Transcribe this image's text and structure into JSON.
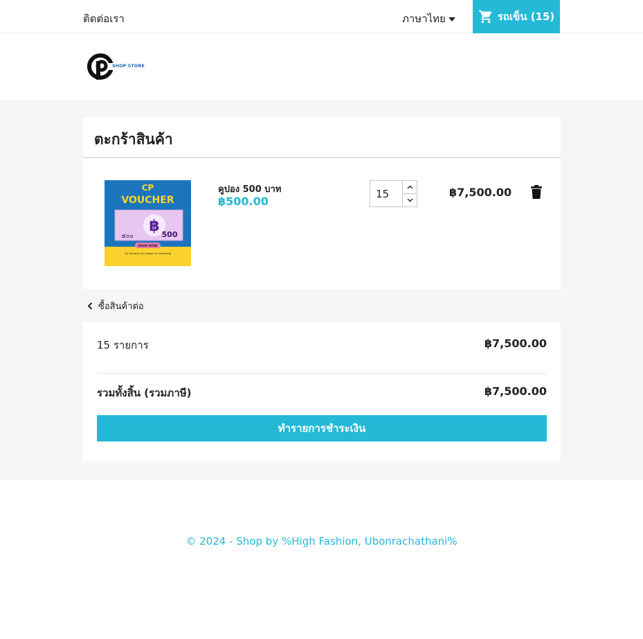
{
  "topbar": {
    "contact_label": "ติดต่อเรา",
    "language_label": "ภาษาไทย",
    "cart_label": "รถเข็น (15)"
  },
  "header": {
    "logo_letter": "P",
    "logo_text": "SHOP STORE"
  },
  "cart": {
    "title": "ตะกร้าสินค้า",
    "items": [
      {
        "name": "คูปอง 500 บาท",
        "unit_price": "฿500.00",
        "quantity": "15",
        "line_total": "฿7,500.00",
        "image": {
          "title_line1": "CP",
          "title_line2": "VOUCHER",
          "baht_symbol": "฿",
          "amount": "500",
          "thai_amount": "๕๐๐",
          "shop_now": "SHOP NOW",
          "caption": "For Students of College of Computing"
        }
      }
    ],
    "continue_label": "ซื้อสินค้าต่อ"
  },
  "summary": {
    "items_count_label": "15 รายการ",
    "items_amount": "฿7,500.00",
    "total_label": "รวมทั้งสิ้น (รวมภาษี)",
    "total_amount": "฿7,500.00",
    "checkout_label": "ทำรายการชำระเงิน"
  },
  "footer": {
    "copyright": "© 2024 - Shop by %High Fashion, Ubonrachathani%"
  },
  "colors": {
    "accent": "#24b9d7",
    "page_bg": "#f6f6f6",
    "text": "#232323"
  }
}
